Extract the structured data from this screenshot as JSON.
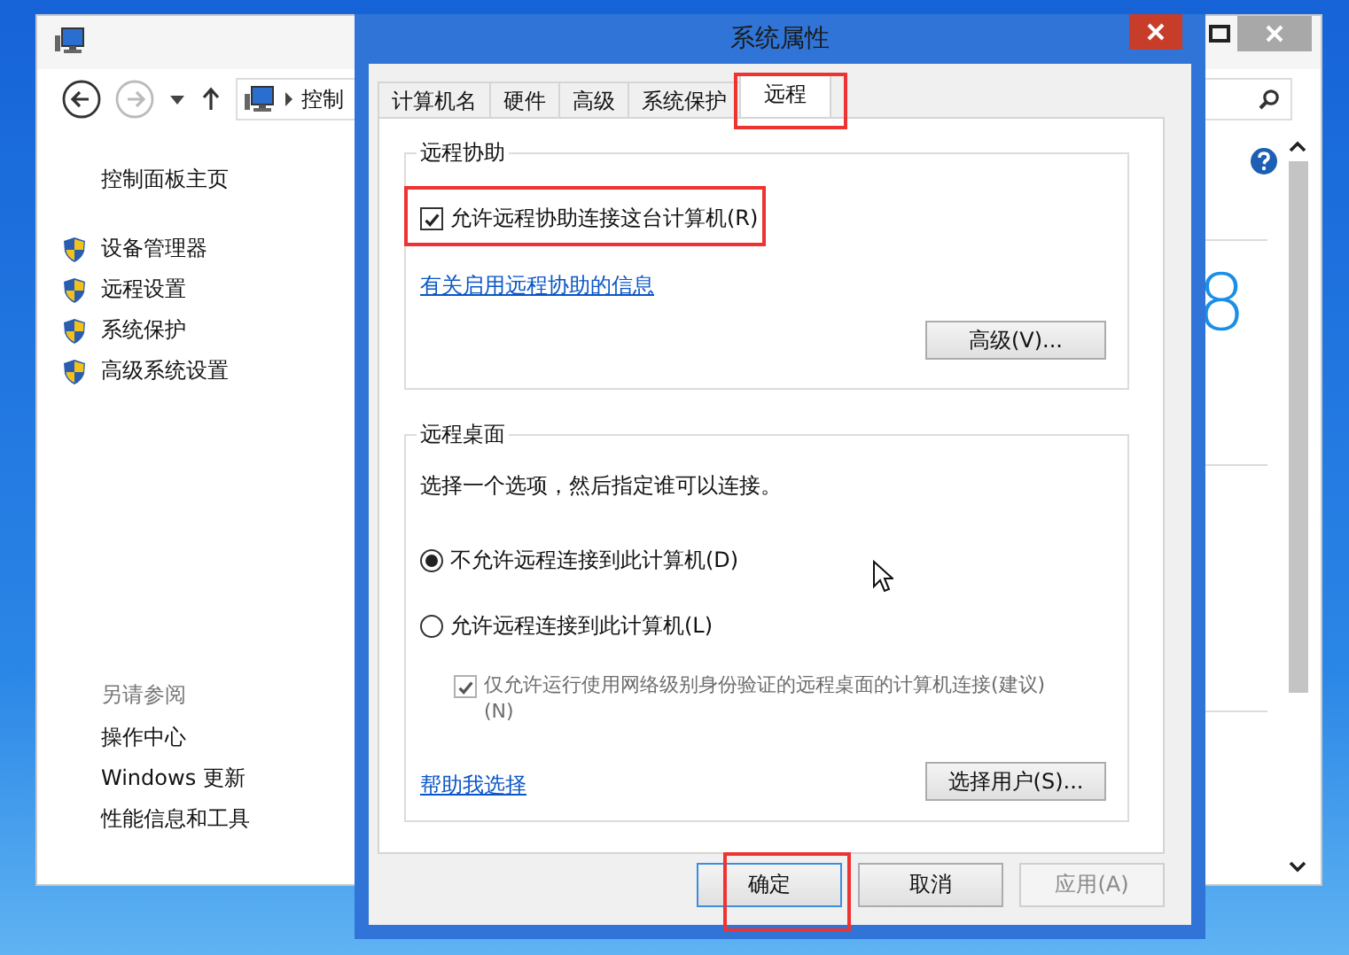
{
  "back_window": {
    "address": "控制",
    "home_link": "控制面板主页",
    "tasks": [
      "设备管理器",
      "远程设置",
      "系统保护",
      "高级系统设置"
    ],
    "see_also": {
      "heading": "另请参阅",
      "links": [
        "操作中心",
        "Windows 更新",
        "性能信息和工具"
      ]
    },
    "logo_fragment": "8"
  },
  "dialog": {
    "title": "系统属性",
    "tabs": [
      {
        "label": "计算机名",
        "selected": false
      },
      {
        "label": "硬件",
        "selected": false
      },
      {
        "label": "高级",
        "selected": false
      },
      {
        "label": "系统保护",
        "selected": false
      },
      {
        "label": "远程",
        "selected": true
      }
    ],
    "remote_assistance": {
      "heading": "远程协助",
      "allow": {
        "label": "允许远程协助连接这台计算机(R)",
        "checked": true
      },
      "info_link": "有关启用远程协助的信息",
      "advanced_button": "高级(V)..."
    },
    "remote_desktop": {
      "heading": "远程桌面",
      "instruction": "选择一个选项，然后指定谁可以连接。",
      "options": [
        {
          "label": "不允许远程连接到此计算机(D)",
          "selected": true
        },
        {
          "label": "允许远程连接到此计算机(L)",
          "selected": false
        }
      ],
      "nla": {
        "label": "仅允许运行使用网络级别身份验证的远程桌面的计算机连接(建议)",
        "access_key": "(N)",
        "checked": true,
        "disabled": true
      },
      "help_link": "帮助我选择",
      "users_button": "选择用户(S)..."
    },
    "buttons": [
      {
        "label": "确定",
        "kind": "default"
      },
      {
        "label": "取消",
        "kind": "normal"
      },
      {
        "label": "应用(A)",
        "kind": "disabled"
      }
    ]
  }
}
